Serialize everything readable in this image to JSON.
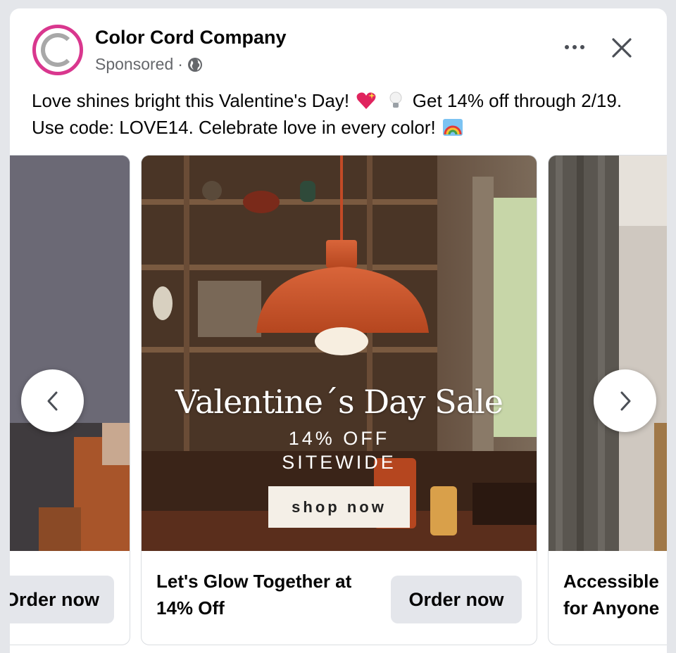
{
  "header": {
    "page_name": "Color Cord Company",
    "sponsored": "Sponsored",
    "separator": "·"
  },
  "post": {
    "text_part1": "Love shines bright this Valentine's Day!",
    "text_part2": "Get 14% off through 2/19. Use code: LOVE14. Celebrate love in every color!",
    "emojis": [
      "sparkling-heart",
      "light-bulb",
      "rainbow"
    ]
  },
  "carousel": {
    "cards": [
      {
        "title": "",
        "cta": "Order now"
      },
      {
        "title": "Let's Glow Together at 14% Off",
        "cta": "Order now",
        "overlay_title": "Valentine´s Day Sale",
        "overlay_line1": "14% OFF",
        "overlay_line2": "SITEWIDE",
        "overlay_button": "shop now"
      },
      {
        "title": "Accessible for Anyone",
        "cta": ""
      }
    ]
  },
  "colors": {
    "avatar_ring": "#d9378e",
    "lamp": "#c8552f",
    "button_bg": "#e4e6eb",
    "secondary_text": "#65676b"
  }
}
